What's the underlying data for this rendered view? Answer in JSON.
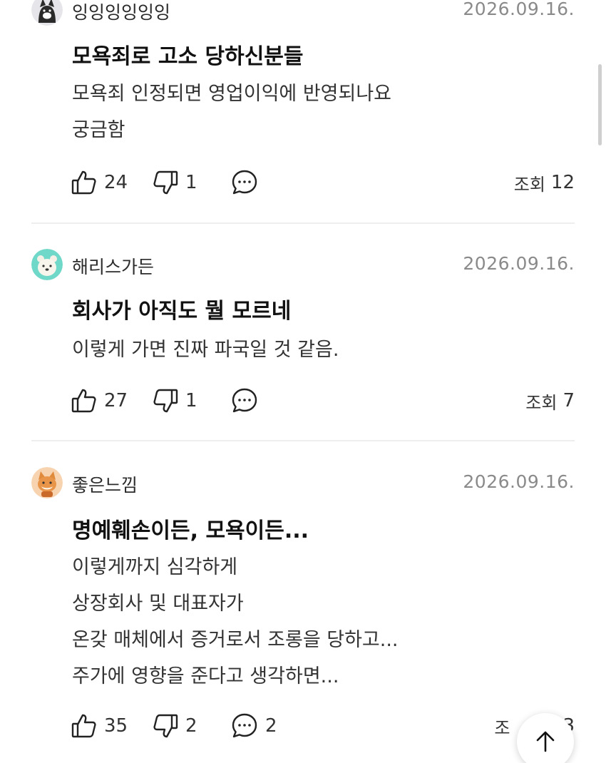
{
  "posts": [
    {
      "author": "잉잉잉잉잉잉",
      "date": "2026.09.16.",
      "title": "모욕죄로 고소 당하신분들",
      "body": [
        "모욕죄 인정되면 영업이익에 반영되나요",
        "궁금함"
      ],
      "likes": "24",
      "dislikes": "1",
      "comments": "",
      "views_label": "조회",
      "views": "12",
      "avatar_icon": "cat-avatar-icon"
    },
    {
      "author": "해리스가든",
      "date": "2026.09.16.",
      "title": "회사가 아직도 뭘 모르네",
      "body": [
        "이렇게 가면 진짜 파국일 것 같음."
      ],
      "likes": "27",
      "dislikes": "1",
      "comments": "",
      "views_label": "조회",
      "views": "7",
      "avatar_icon": "bear-avatar-icon"
    },
    {
      "author": "좋은느낌",
      "date": "2026.09.16.",
      "title": "명예훼손이든, 모욕이든...",
      "body": [
        "이렇게까지 심각하게",
        "상장회사 및 대표자가",
        "온갖 매체에서 증거로서 조롱을 당하고...",
        "주가에 영향을 준다고 생각하면..."
      ],
      "likes": "35",
      "dislikes": "2",
      "comments": "2",
      "views_label": "조",
      "views": "3",
      "avatar_icon": "fox-avatar-icon"
    }
  ],
  "colors": {
    "text": "#111111",
    "meta": "#8a8a8a",
    "divider": "#eeeeee"
  },
  "scroll_top_icon": "arrow-up-icon"
}
